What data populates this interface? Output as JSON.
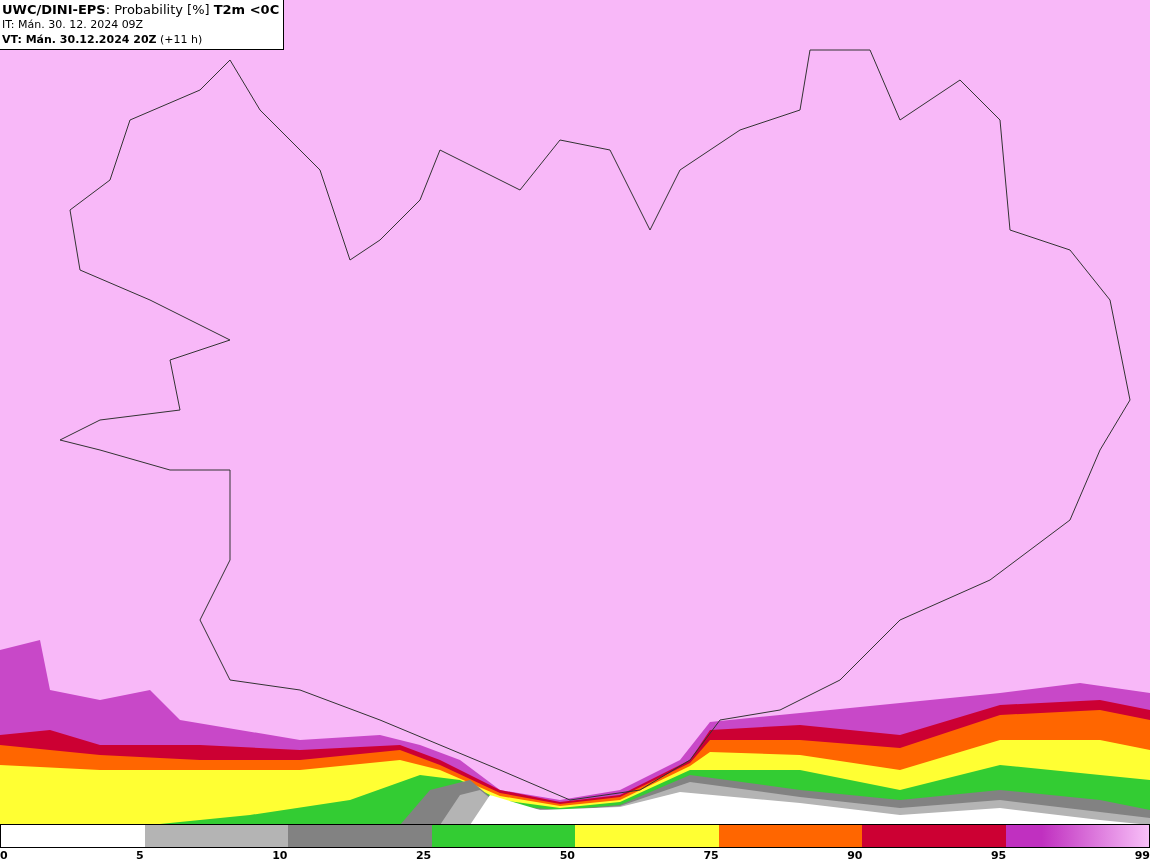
{
  "header": {
    "title": "**UWC/DINI-EPS**: Probability [%] **T2m <0C**",
    "init_time": "IT: Mán. 30. 12. 2024 09Z",
    "valid_time": "**VT: Mán. 30.12.2024 20Z** (+11 h)"
  },
  "legend": {
    "segments": [
      {
        "color": "#ffffff"
      },
      {
        "color": "#b4b4b4"
      },
      {
        "color": "#828282"
      },
      {
        "color": "#33cc33"
      },
      {
        "color": "#ffff33"
      },
      {
        "color": "#ff6600"
      },
      {
        "color": "#cc0033"
      },
      {
        "color": "#c030c0"
      }
    ],
    "ticks": [
      "0",
      "5",
      "10",
      "25",
      "50",
      "75",
      "90",
      "95",
      "99"
    ]
  }
}
